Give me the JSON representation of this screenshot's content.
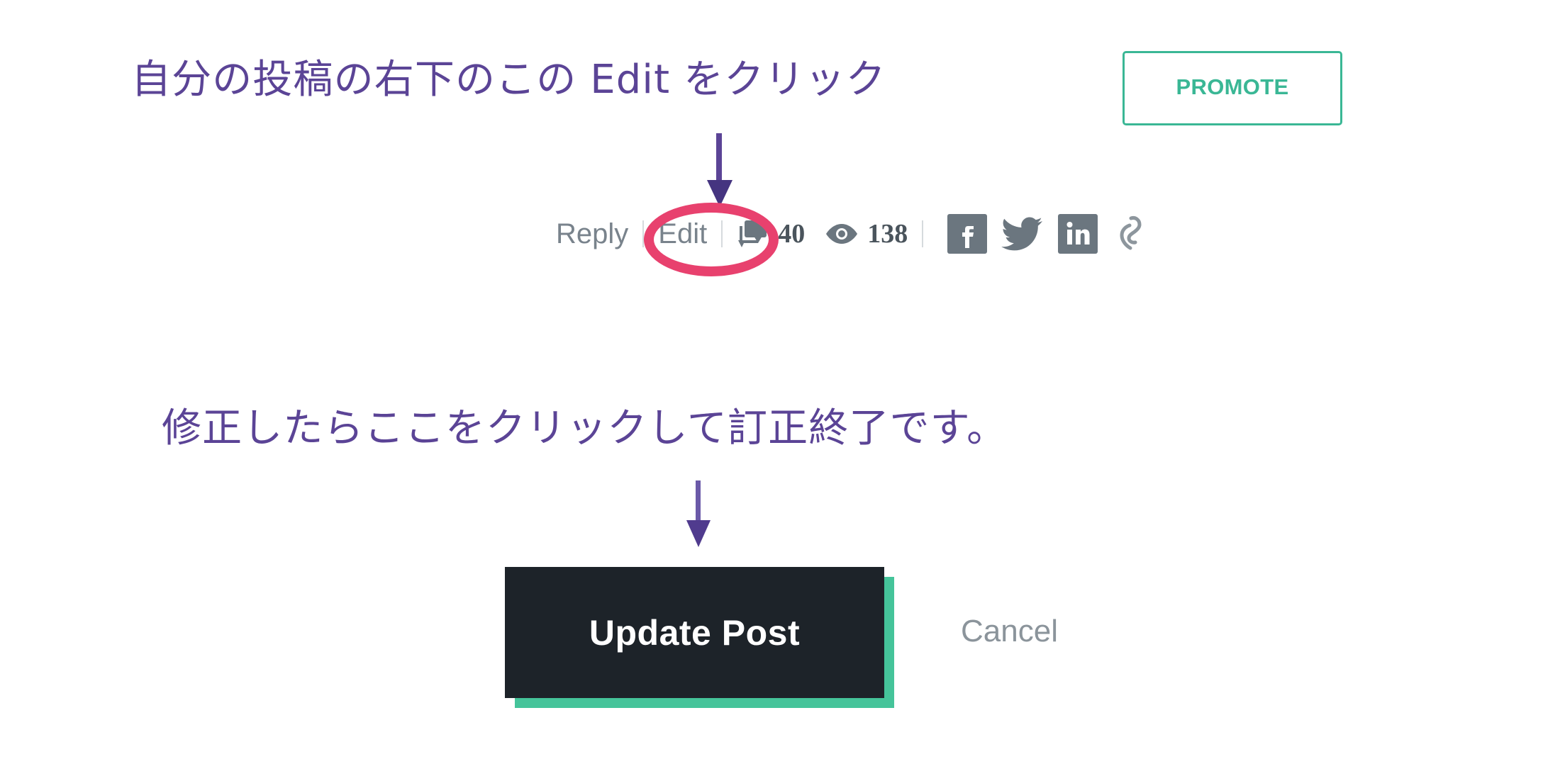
{
  "annotations": {
    "line1": "自分の投稿の右下のこの Edit をクリック",
    "line2": "修正したらここをクリックして訂正終了です。",
    "arrow_top_name": "down-arrow-icon",
    "arrow_mid_name": "down-arrow-icon",
    "highlight_target": "Edit"
  },
  "promote": {
    "label": "PROMOTE"
  },
  "post_meta": {
    "reply_label": "Reply",
    "edit_label": "Edit",
    "comments_count": "40",
    "views_count": "138",
    "social": [
      {
        "name": "facebook-icon",
        "label": "f"
      },
      {
        "name": "twitter-icon",
        "label": ""
      },
      {
        "name": "linkedin-icon",
        "label": "in"
      },
      {
        "name": "link-icon",
        "label": ""
      }
    ]
  },
  "editor_actions": {
    "update_label": "Update Post",
    "cancel_label": "Cancel"
  },
  "colors": {
    "annotation_purple": "#5b4496",
    "highlight_pink": "#e8416e",
    "promote_teal": "#3ab795",
    "button_dark": "#1d2329",
    "button_shadow_teal": "#45c49a",
    "meta_gray": "#79838c",
    "social_gray": "#6b767f",
    "background": "#ffffff"
  }
}
